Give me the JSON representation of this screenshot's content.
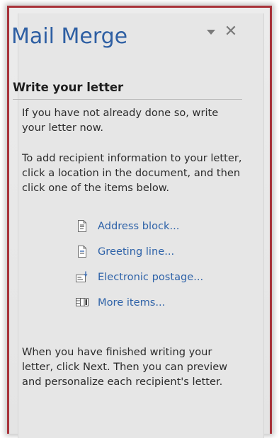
{
  "pane": {
    "title": "Mail Merge"
  },
  "section": {
    "heading": "Write your letter",
    "intro": "If you have not already done so, write your letter now.",
    "instructions": "To add recipient information to your letter, click a location in the document, and then click one of the items below.",
    "footer": "When you have finished writing your letter, click Next. Then you can preview and personalize each recipient's letter."
  },
  "links": [
    {
      "label": "Address block...",
      "icon": "address-block-icon"
    },
    {
      "label": "Greeting line...",
      "icon": "greeting-line-icon"
    },
    {
      "label": "Electronic postage...",
      "icon": "electronic-postage-icon"
    },
    {
      "label": "More items...",
      "icon": "more-items-icon"
    }
  ],
  "colors": {
    "title": "#2e5fa3",
    "link": "#2e62a8",
    "frame_border": "#a8323a"
  }
}
